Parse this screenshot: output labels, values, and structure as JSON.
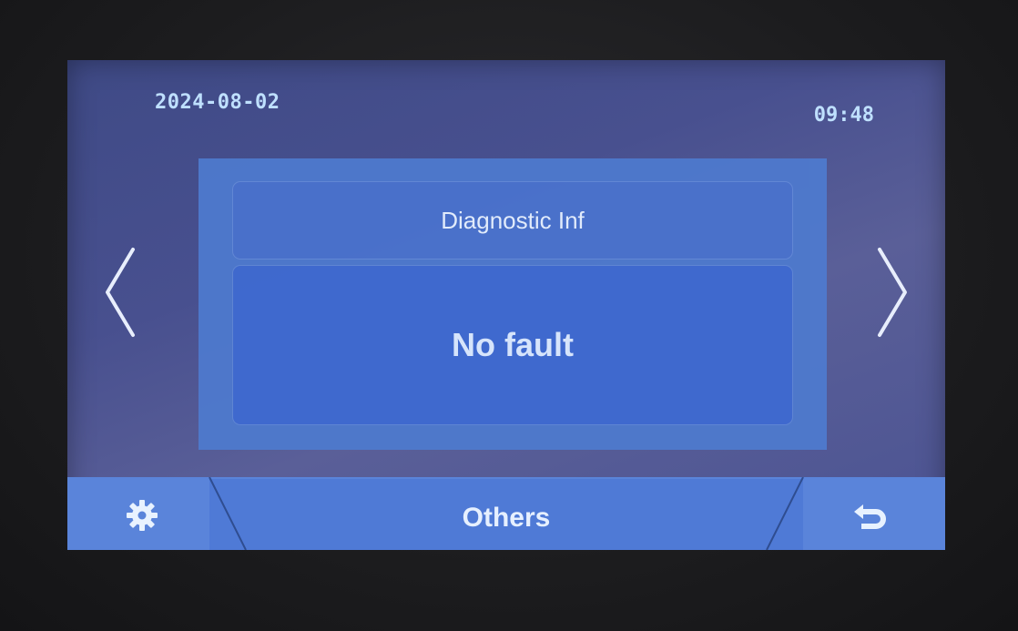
{
  "header": {
    "date": "2024-08-02",
    "time": "09:48"
  },
  "panel": {
    "title": "Diagnostic Inf",
    "status": "No fault"
  },
  "footer": {
    "label": "Others",
    "left_icon": "gear-icon",
    "right_icon": "back-arrow-icon"
  },
  "colors": {
    "accent_text": "#bfe0ff",
    "panel_blue": "#4e79cc",
    "bar_blue": "#5a84da"
  }
}
